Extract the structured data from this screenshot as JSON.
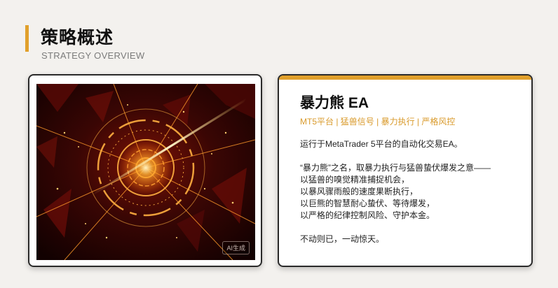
{
  "header": {
    "title": "策略概述",
    "subtitle": "STRATEGY OVERVIEW"
  },
  "image": {
    "badge": "AI生成"
  },
  "ea": {
    "title": "暴力熊 EA",
    "tags": "MT5平台 | 猛兽信号 | 暴力执行 | 严格风控",
    "intro": "运行于MetaTrader 5平台的自动化交易EA。",
    "lines": [
      "“暴力熊”之名，取暴力执行与猛兽蛰伏爆发之意——",
      "以猛兽的嗅觉精准捕捉机会，",
      "以暴风骤雨般的速度果断执行，",
      "以巨熊的智慧耐心蛰伏、等待爆发，",
      "以严格的纪律控制风险、守护本金。"
    ],
    "closing": "不动则已，一动惊天。"
  },
  "colors": {
    "accent": "#e1a02b",
    "tag_text": "#d99a2b",
    "background": "#f3f1ee"
  }
}
